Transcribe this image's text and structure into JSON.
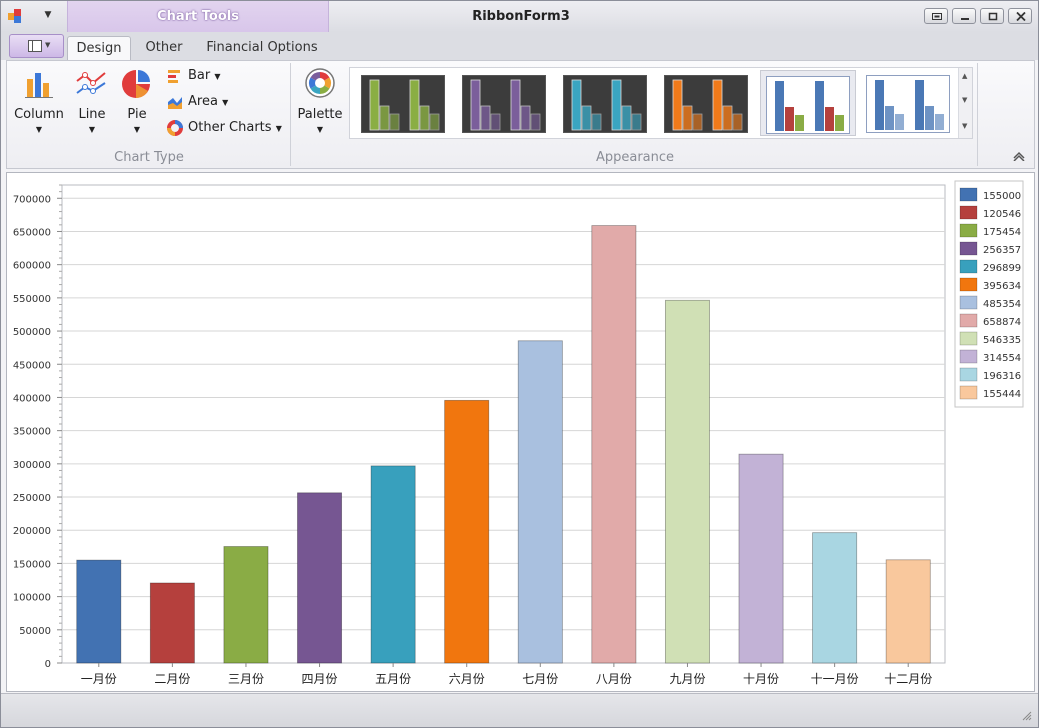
{
  "window": {
    "title": "RibbonForm3",
    "context_tab": "Chart Tools"
  },
  "tabs": [
    "Design",
    "Other",
    "Financial Options"
  ],
  "ribbon": {
    "chart_type_group": {
      "label": "Chart Type",
      "column_label": "Column",
      "line_label": "Line",
      "pie_label": "Pie",
      "bar_label": "Bar",
      "area_label": "Area",
      "other_label": "Other Charts"
    },
    "appearance_group": {
      "label": "Appearance",
      "palette_label": "Palette",
      "styles": [
        {
          "bg": "dark",
          "color": "#8aae43"
        },
        {
          "bg": "dark",
          "color": "#7b5e9b"
        },
        {
          "bg": "dark",
          "color": "#3aa5c1"
        },
        {
          "bg": "dark",
          "color": "#f07a1a"
        },
        {
          "bg": "light",
          "color": "multi",
          "selected": true
        },
        {
          "bg": "light",
          "color": "#4a78b5"
        }
      ]
    }
  },
  "chart_data": {
    "type": "bar",
    "categories": [
      "一月份",
      "二月份",
      "三月份",
      "四月份",
      "五月份",
      "六月份",
      "七月份",
      "八月份",
      "九月份",
      "十月份",
      "十一月份",
      "十二月份"
    ],
    "values": [
      155000,
      120546,
      175454,
      256357,
      296899,
      395634,
      485354,
      658874,
      546335,
      314554,
      196316,
      155444
    ],
    "colors": [
      "#4272b2",
      "#b5403d",
      "#8aac45",
      "#765692",
      "#38a0bd",
      "#f1760e",
      "#a9c0df",
      "#e1aaa9",
      "#d0e0b5",
      "#c2b2d6",
      "#a9d6e2",
      "#f9c89d"
    ],
    "legend": [
      "155000",
      "120546",
      "175454",
      "256357",
      "296899",
      "395634",
      "485354",
      "658874",
      "546335",
      "314554",
      "196316",
      "155444"
    ],
    "legend_position": "top-right",
    "ylim": [
      0,
      720000
    ],
    "yticks": [
      0,
      50000,
      100000,
      150000,
      200000,
      250000,
      300000,
      350000,
      400000,
      450000,
      500000,
      550000,
      600000,
      650000,
      700000
    ],
    "grid": true,
    "title": "",
    "xlabel": "",
    "ylabel": ""
  }
}
